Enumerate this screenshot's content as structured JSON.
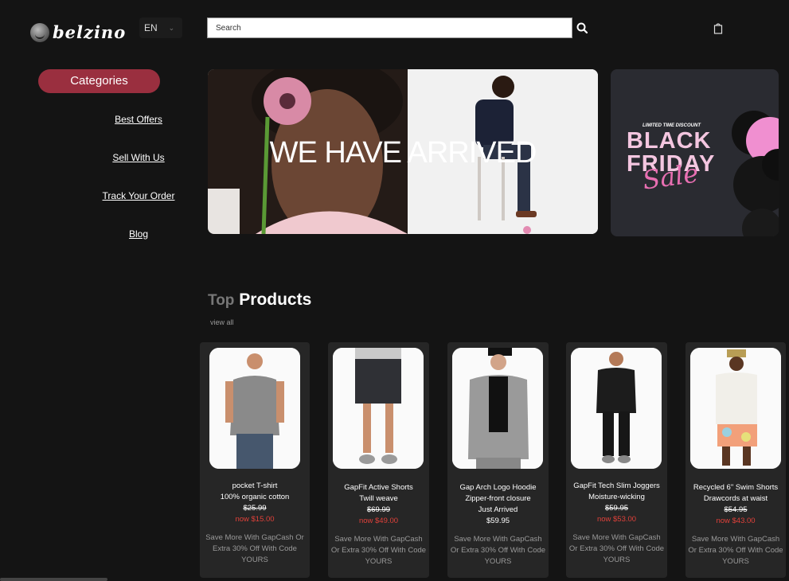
{
  "logo": {
    "text": "belzino"
  },
  "language": {
    "selected": "EN"
  },
  "search": {
    "placeholder": "Search"
  },
  "sidebar": {
    "categories_label": "Categories",
    "links": [
      "Best Offers",
      "Sell With Us",
      "Track Your Order",
      "Blog"
    ]
  },
  "hero": {
    "title": "WE HAVE ARRIVED"
  },
  "promo": {
    "subtitle": "LIMITED TIME DISCOUNT",
    "line1": "BLACK",
    "line2": "FRIDAY",
    "script": "Sale"
  },
  "section": {
    "title_light": "Top",
    "title_bold": "Products",
    "view_all": "view all"
  },
  "products": [
    {
      "name": "pocket T-shirt",
      "desc": "100% organic cotton",
      "old_price": "$25.99",
      "new_price": "now $15.00",
      "promo": "Save More With GapCash Or Extra 30% Off With Code YOURS"
    },
    {
      "name": "GapFit Active Shorts",
      "desc": "Twill weave",
      "old_price": "$69.99",
      "new_price": "now $49.00",
      "promo": "Save More With GapCash Or Extra 30% Off With Code YOURS"
    },
    {
      "name": "Gap Arch Logo Hoodie",
      "desc": "Zipper-front closure",
      "extra": "Just Arrived",
      "price": "$59.95",
      "promo": "Save More With GapCash Or Extra 30% Off With Code YOURS"
    },
    {
      "name": "GapFit Tech Slim Joggers",
      "desc": "Moisture-wicking",
      "old_price": "$59.95",
      "new_price": "now $53.00",
      "promo": "Save More With GapCash Or Extra 30% Off With Code YOURS"
    },
    {
      "name": "Recycled 6\" Swim Shorts",
      "desc": "Drawcords at waist",
      "old_price": "$54.95",
      "new_price": "now $43.00",
      "promo": "Save More With GapCash Or Extra 30% Off With Code YOURS"
    }
  ],
  "colors": {
    "background": "#141414",
    "accent": "#9a2f3f",
    "sale_price": "#e0413a",
    "card": "#262626"
  }
}
